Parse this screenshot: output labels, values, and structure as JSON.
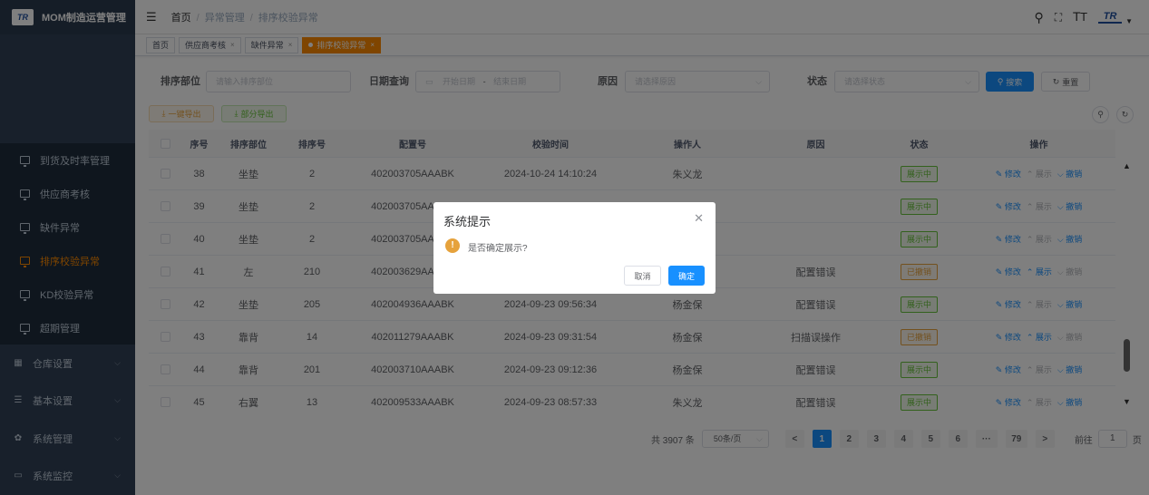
{
  "app": {
    "title": "MOM制造运营管理",
    "logo_text": "TR"
  },
  "sidebar": {
    "submenu": [
      {
        "label": "到货及时率管理",
        "active": false
      },
      {
        "label": "供应商考核",
        "active": false
      },
      {
        "label": "缺件异常",
        "active": false
      },
      {
        "label": "排序校验异常",
        "active": true
      },
      {
        "label": "KD校验异常",
        "active": false
      },
      {
        "label": "超期管理",
        "active": false
      }
    ],
    "groups": [
      {
        "label": "仓库设置",
        "icon": "grid-icon"
      },
      {
        "label": "基本设置",
        "icon": "list-icon"
      },
      {
        "label": "系统管理",
        "icon": "gear-icon"
      },
      {
        "label": "系统监控",
        "icon": "monitor-icon"
      }
    ]
  },
  "header": {
    "breadcrumb": [
      "首页",
      "异常管理",
      "排序校验异常"
    ]
  },
  "tags": [
    {
      "label": "首页",
      "closable": false,
      "active": false
    },
    {
      "label": "供应商考核",
      "closable": true,
      "active": false
    },
    {
      "label": "缺件异常",
      "closable": true,
      "active": false
    },
    {
      "label": "排序校验异常",
      "closable": true,
      "active": true
    }
  ],
  "filter": {
    "dept_label": "排序部位",
    "dept_placeholder": "请输入排序部位",
    "date_label": "日期查询",
    "date_start_placeholder": "开始日期",
    "date_sep": "-",
    "date_end_placeholder": "结束日期",
    "reason_label": "原因",
    "reason_placeholder": "请选择原因",
    "status_label": "状态",
    "status_placeholder": "请选择状态",
    "search_label": "搜索",
    "reset_label": "重置"
  },
  "toolbar": {
    "export_all": "一键导出",
    "export_part": "部分导出"
  },
  "table": {
    "columns": [
      "序号",
      "排序部位",
      "排序号",
      "配置号",
      "校验时间",
      "操作人",
      "原因",
      "状态",
      "操作"
    ],
    "rows": [
      {
        "no": "38",
        "dept": "坐垫",
        "seq": "2",
        "config": "402003705AAABK",
        "time": "2024-10-24 14:10:24",
        "user": "朱义龙",
        "reason": "",
        "status": "展示中",
        "status_type": "show",
        "actions": [
          {
            "label": "修改",
            "on": true
          },
          {
            "label": "展示",
            "on": false
          },
          {
            "label": "撤销",
            "on": true
          }
        ]
      },
      {
        "no": "39",
        "dept": "坐垫",
        "seq": "2",
        "config": "402003705AAABK",
        "time": "",
        "user": "",
        "reason": "",
        "status": "展示中",
        "status_type": "show",
        "actions": [
          {
            "label": "修改",
            "on": true
          },
          {
            "label": "展示",
            "on": false
          },
          {
            "label": "撤销",
            "on": true
          }
        ]
      },
      {
        "no": "40",
        "dept": "坐垫",
        "seq": "2",
        "config": "402003705AAABK",
        "time": "",
        "user": "",
        "reason": "",
        "status": "展示中",
        "status_type": "show",
        "actions": [
          {
            "label": "修改",
            "on": true
          },
          {
            "label": "展示",
            "on": false
          },
          {
            "label": "撤销",
            "on": true
          }
        ]
      },
      {
        "no": "41",
        "dept": "左",
        "seq": "210",
        "config": "402003629AAABK",
        "time": "",
        "user": "",
        "reason": "配置错误",
        "status": "已撤销",
        "status_type": "rev",
        "actions": [
          {
            "label": "修改",
            "on": true
          },
          {
            "label": "展示",
            "on": true
          },
          {
            "label": "撤销",
            "on": false
          }
        ]
      },
      {
        "no": "42",
        "dept": "坐垫",
        "seq": "205",
        "config": "402004936AAABK",
        "time": "2024-09-23 09:56:34",
        "user": "杨金保",
        "reason": "配置错误",
        "status": "展示中",
        "status_type": "show",
        "actions": [
          {
            "label": "修改",
            "on": true
          },
          {
            "label": "展示",
            "on": false
          },
          {
            "label": "撤销",
            "on": true
          }
        ]
      },
      {
        "no": "43",
        "dept": "靠背",
        "seq": "14",
        "config": "402011279AAABK",
        "time": "2024-09-23 09:31:54",
        "user": "杨金保",
        "reason": "扫描误操作",
        "status": "已撤销",
        "status_type": "rev",
        "actions": [
          {
            "label": "修改",
            "on": true
          },
          {
            "label": "展示",
            "on": true
          },
          {
            "label": "撤销",
            "on": false
          }
        ]
      },
      {
        "no": "44",
        "dept": "靠背",
        "seq": "201",
        "config": "402003710AAABK",
        "time": "2024-09-23 09:12:36",
        "user": "杨金保",
        "reason": "配置错误",
        "status": "展示中",
        "status_type": "show",
        "actions": [
          {
            "label": "修改",
            "on": true
          },
          {
            "label": "展示",
            "on": false
          },
          {
            "label": "撤销",
            "on": true
          }
        ]
      },
      {
        "no": "45",
        "dept": "右翼",
        "seq": "13",
        "config": "402009533AAABK",
        "time": "2024-09-23 08:57:33",
        "user": "朱义龙",
        "reason": "配置错误",
        "status": "展示中",
        "status_type": "show",
        "actions": [
          {
            "label": "修改",
            "on": true
          },
          {
            "label": "展示",
            "on": false
          },
          {
            "label": "撤销",
            "on": true
          }
        ]
      }
    ]
  },
  "pagination": {
    "total": "共 3907 条",
    "page_size": "50条/页",
    "prev": "<",
    "pages": [
      "1",
      "2",
      "3",
      "4",
      "5",
      "6",
      "···",
      "79"
    ],
    "current": "1",
    "next": ">",
    "goto_label": "前往",
    "goto_value": "1",
    "goto_suffix": "页"
  },
  "dialog": {
    "title": "系统提示",
    "message": "是否确定展示?",
    "cancel": "取消",
    "ok": "确定",
    "warn_glyph": "!"
  },
  "colors": {
    "primary": "#1890ff",
    "accent": "#ff8a00",
    "sidebar": "#304156",
    "success": "#67c23a",
    "warning": "#e6a23c"
  }
}
